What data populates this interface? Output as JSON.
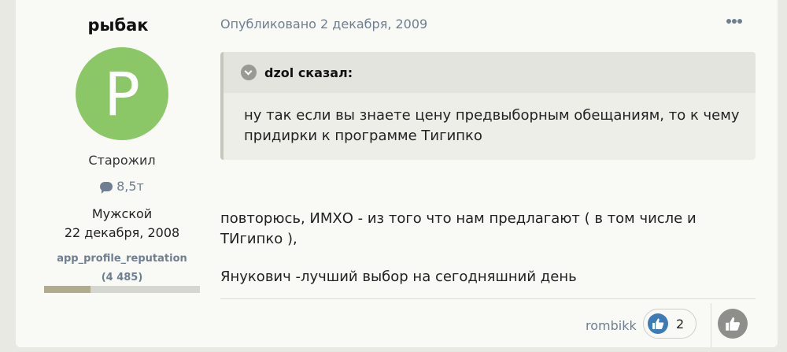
{
  "author": {
    "name": "рыбак",
    "avatar_letter": "P",
    "avatar_color": "#8bc766",
    "rank": "Старожил",
    "posts_icon": "comment-icon",
    "posts_count": "8,5т",
    "gender": "Мужской",
    "joined": "22 декабря, 2008",
    "reputation_label": "app_profile_reputation",
    "reputation_value": "(4 485)",
    "reputation_fill_fraction": 0.3
  },
  "post": {
    "date": "Опубликовано 2 декабря, 2009",
    "more_icon": "ellipsis-icon",
    "quote": {
      "author": "dzol сказал:",
      "toggle_icon": "chevron-down-circle-icon",
      "text": "ну так если вы знаете цену предвыборным обещаниям, то к чему придирки к программе Тигипко"
    },
    "paragraphs": [
      "повторюсь, ИМХО - из того что нам предлагают ( в том числе и ТИгипко ),",
      "Янукович -лучший выбор на сегодняшний день"
    ]
  },
  "reactions": {
    "liked_by": "rombikk",
    "like_icon": "thumbs-up-icon",
    "count": "2",
    "react_button_icon": "thumbs-up-icon",
    "accent_color": "#3c7bb5"
  }
}
